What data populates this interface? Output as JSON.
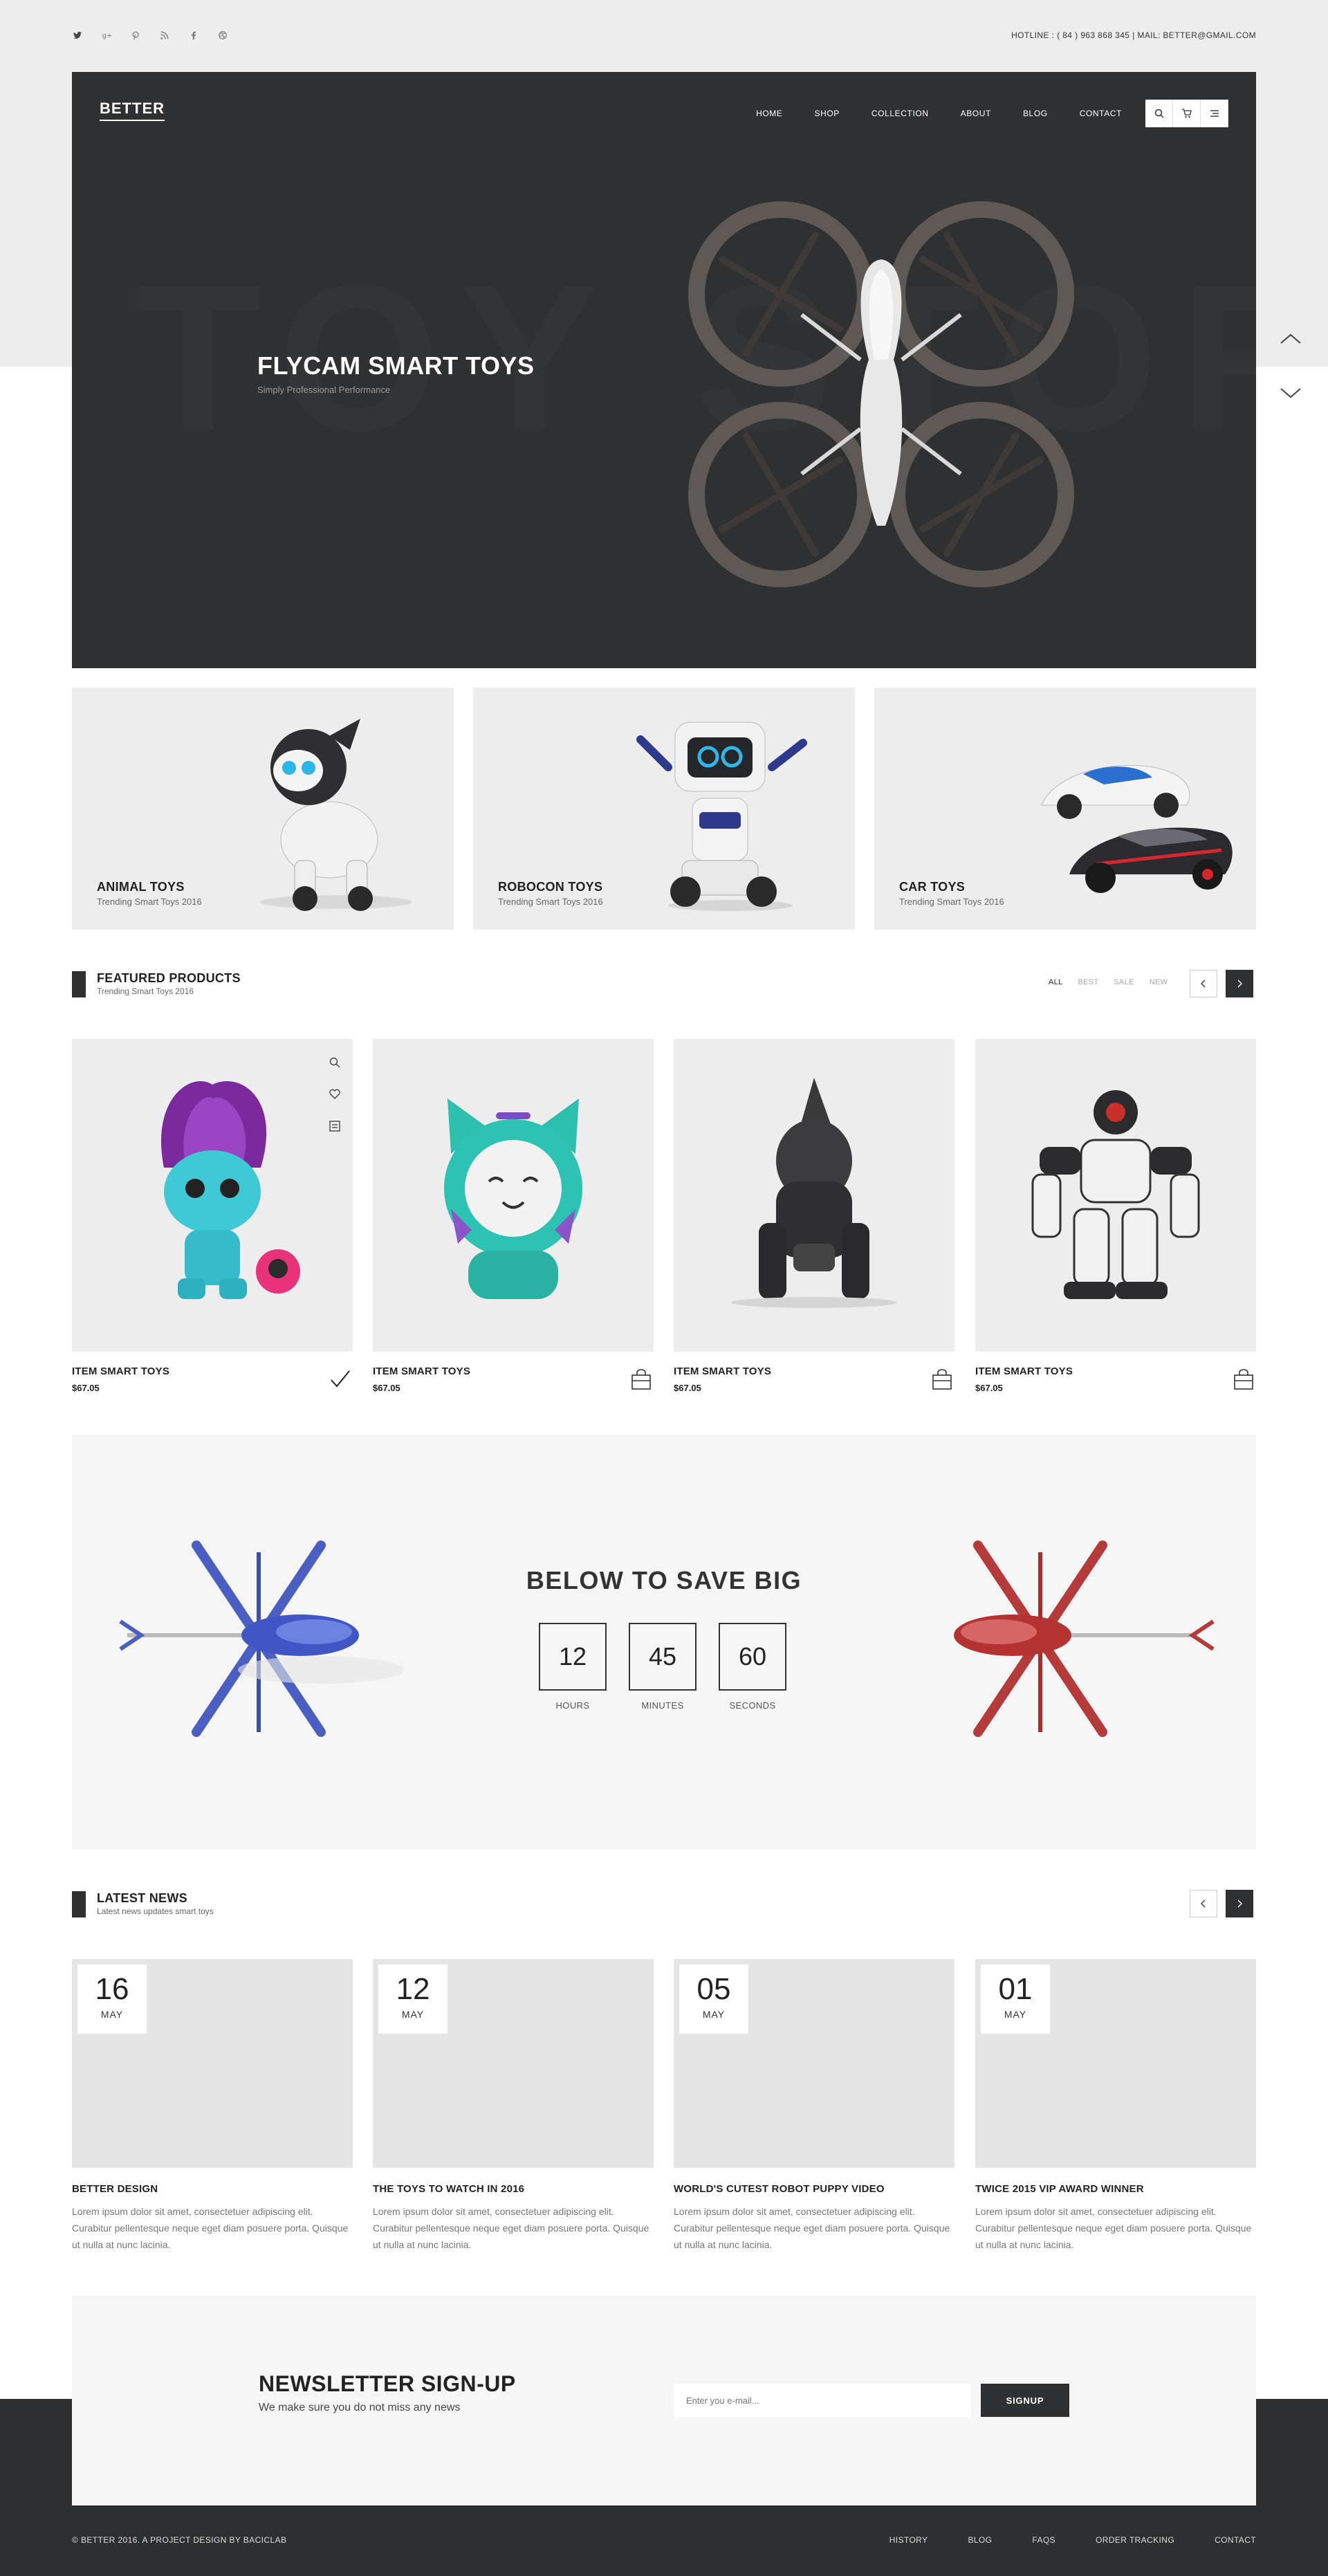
{
  "topbar": {
    "contact": "HOTLINE : ( 84 ) 963 868 345  |  MAIL: BETTER@GMAIL.COM",
    "socials": [
      "twitter-icon",
      "google-plus-icon",
      "pinterest-icon",
      "rss-icon",
      "facebook-icon",
      "dribbble-icon"
    ]
  },
  "header": {
    "logo": "BETTER",
    "nav": [
      "HOME",
      "SHOP",
      "COLLECTION",
      "ABOUT",
      "BLOG",
      "CONTACT"
    ],
    "icons": [
      "search-icon",
      "cart-icon",
      "menu-icon"
    ]
  },
  "hero": {
    "title": "FLYCAM SMART TOYS",
    "subtitle": "Simply Professional Performance",
    "background_text": "TOY STORE"
  },
  "categories": [
    {
      "title": "ANIMAL TOYS",
      "subtitle": "Trending Smart Toys 2016"
    },
    {
      "title": "ROBOCON TOYS",
      "subtitle": "Trending Smart Toys 2016"
    },
    {
      "title": "CAR TOYS",
      "subtitle": "Trending Smart Toys 2016"
    }
  ],
  "featured": {
    "title": "FEATURED PRODUCTS",
    "subtitle": "Trending Smart Toys 2016",
    "filters": [
      "ALL",
      "BEST",
      "SALE",
      "NEW"
    ],
    "active_filter": "ALL",
    "products": [
      {
        "name": "ITEM SMART TOYS",
        "price": "$67.05",
        "in_cart": true
      },
      {
        "name": "ITEM SMART TOYS",
        "price": "$67.05",
        "in_cart": false
      },
      {
        "name": "ITEM SMART TOYS",
        "price": "$67.05",
        "in_cart": false
      },
      {
        "name": "ITEM SMART TOYS",
        "price": "$67.05",
        "in_cart": false
      }
    ]
  },
  "promo": {
    "title": "BELOW TO SAVE BIG",
    "counters": [
      {
        "value": "12",
        "label": "HOURS"
      },
      {
        "value": "45",
        "label": "MINUTES"
      },
      {
        "value": "60",
        "label": "SECONDS"
      }
    ]
  },
  "news": {
    "title": "LATEST NEWS",
    "subtitle": "Latest news updates smart toys",
    "items": [
      {
        "day": "16",
        "month": "MAY",
        "title": "BETTER DESIGN",
        "text": "Lorem ipsum dolor sit amet, consectetuer adipiscing elit. Curabitur pellentesque neque eget diam posuere porta. Quisque ut nulla at nunc lacinia."
      },
      {
        "day": "12",
        "month": "MAY",
        "title": "THE TOYS TO WATCH IN 2016",
        "text": "Lorem ipsum dolor sit amet, consectetuer adipiscing elit. Curabitur pellentesque neque eget diam posuere porta. Quisque ut nulla at nunc lacinia."
      },
      {
        "day": "05",
        "month": "MAY",
        "title": "WORLD'S CUTEST ROBOT PUPPY VIDEO",
        "text": "Lorem ipsum dolor sit amet, consectetuer adipiscing elit. Curabitur pellentesque neque eget diam posuere porta. Quisque ut nulla at nunc lacinia."
      },
      {
        "day": "01",
        "month": "MAY",
        "title": "TWICE 2015 VIP AWARD WINNER",
        "text": "Lorem ipsum dolor sit amet, consectetuer adipiscing elit. Curabitur pellentesque neque eget diam posuere porta. Quisque ut nulla at nunc lacinia."
      }
    ]
  },
  "newsletter": {
    "title": "NEWSLETTER SIGN-UP",
    "subtitle": "We make sure you do not miss any news",
    "placeholder": "Enter you e-mail...",
    "button": "SIGNUP"
  },
  "footer": {
    "copyright": "© BETTER 2016. A PROJECT DESIGN BY BACICLAB",
    "links": [
      "HISTORY",
      "BLOG",
      "FAQS",
      "ORDER TRACKING",
      "CONTACT"
    ]
  },
  "colors": {
    "dark": "#2e3032",
    "light_gray": "#ededed",
    "panel": "#f6f6f6",
    "accent_blue": "#4a5fc1",
    "accent_red": "#b53a3a"
  }
}
